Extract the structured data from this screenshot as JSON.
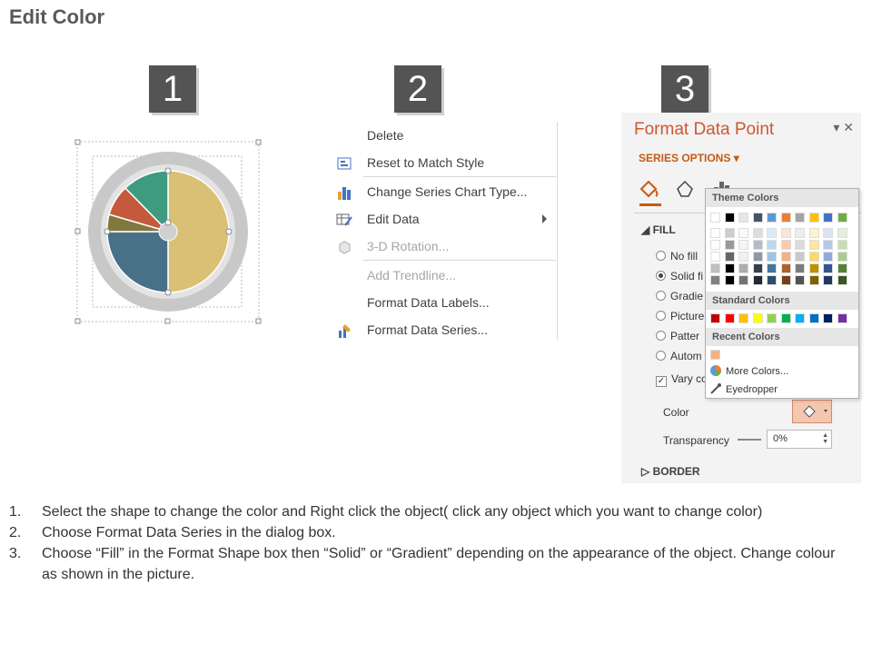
{
  "title": "Edit Color",
  "steps": [
    "1",
    "2",
    "3"
  ],
  "context_menu": {
    "items": [
      {
        "label": "Delete",
        "icon": "none"
      },
      {
        "label": "Reset to Match Style",
        "icon": "reset-style-icon"
      },
      {
        "label": "Change Series Chart Type...",
        "icon": "bar-chart-icon"
      },
      {
        "label": "Edit Data",
        "icon": "edit-data-icon"
      },
      {
        "label": "3-D Rotation...",
        "icon": "cube-icon"
      },
      {
        "label": "Add Trendline...",
        "icon": "none"
      },
      {
        "label": "Format Data Labels...",
        "icon": "none"
      },
      {
        "label": "Format Data Series...",
        "icon": "format-series-icon"
      }
    ]
  },
  "panel": {
    "title": "Format Data Point",
    "series_options": "SERIES OPTIONS",
    "fill_header": "FILL",
    "fill_options": [
      "No fill",
      "Solid fi",
      "Gradie",
      "Picture",
      "Patter",
      "Autom"
    ],
    "vary_colors": "Vary co",
    "color_label": "Color",
    "transparency_label": "Transparency",
    "transparency_value": "0%",
    "border_header": "BORDER"
  },
  "dropdown": {
    "theme_colors_label": "Theme Colors",
    "standard_colors_label": "Standard Colors",
    "recent_colors_label": "Recent Colors",
    "more_colors": "More Colors...",
    "eyedropper": "Eyedropper",
    "theme_top": [
      "#ffffff",
      "#000000",
      "#e7e6e6",
      "#44546a",
      "#5b9bd5",
      "#ed7d31",
      "#a5a5a5",
      "#ffc000",
      "#4472c4",
      "#70ad47"
    ],
    "standard": [
      "#c00000",
      "#ff0000",
      "#ffc000",
      "#ffff00",
      "#92d050",
      "#00b050",
      "#00b0f0",
      "#0070c0",
      "#002060",
      "#7030a0"
    ],
    "recent": [
      "#f4b183"
    ]
  },
  "pie_colors": [
    "#d9c074",
    "#487188",
    "#80783f",
    "#c45a3b",
    "#3e9b7f"
  ],
  "instructions": [
    {
      "num": "1.",
      "text": "Select the shape to change the color and Right click the object( click any object which you want to change color)"
    },
    {
      "num": "2.",
      "text": "Choose Format Data Series in the dialog box."
    },
    {
      "num": "3.",
      "text": "Choose “Fill” in the Format Shape box then “Solid” or “Gradient” depending on the appearance of the object. Change colour as shown in the picture."
    }
  ]
}
